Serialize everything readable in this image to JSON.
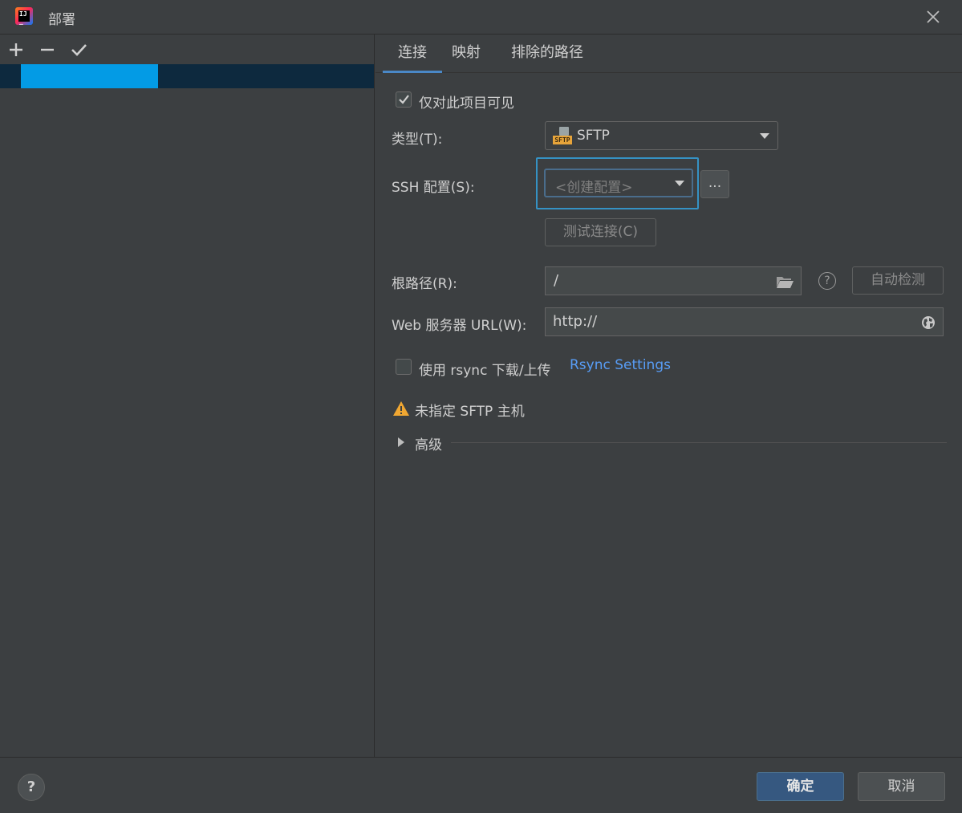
{
  "window": {
    "title": "部署"
  },
  "toolbar": {
    "add": "+",
    "remove": "−",
    "check": "✓"
  },
  "tabs": [
    {
      "label": "连接",
      "active": true
    },
    {
      "label": "映射",
      "active": false
    },
    {
      "label": "排除的路径",
      "active": false
    }
  ],
  "form": {
    "visible_only_label": "仅对此项目可见",
    "visible_only_checked": true,
    "type_label": "类型(T):",
    "type_value": "SFTP",
    "type_icon_text": "SFTP",
    "ssh_label": "SSH 配置(S):",
    "ssh_value": "<创建配置>",
    "ssh_more": "...",
    "test_connection": "测试连接(C)",
    "root_label": "根路径(R):",
    "root_value": "/",
    "autodetect": "自动检测",
    "help_glyph": "?",
    "web_url_label": "Web 服务器 URL(W):",
    "web_url_value": "http://",
    "rsync_label": "使用 rsync 下载/上传",
    "rsync_checked": false,
    "rsync_link": "Rsync Settings",
    "warning": "未指定 SFTP 主机",
    "advanced": "高级"
  },
  "footer": {
    "help": "?",
    "ok": "确定",
    "cancel": "取消"
  },
  "colors": {
    "accent": "#4a88c7",
    "focus": "#3592c4",
    "selection_block": "#039be5",
    "warning": "#f0a732",
    "link": "#589df6"
  }
}
